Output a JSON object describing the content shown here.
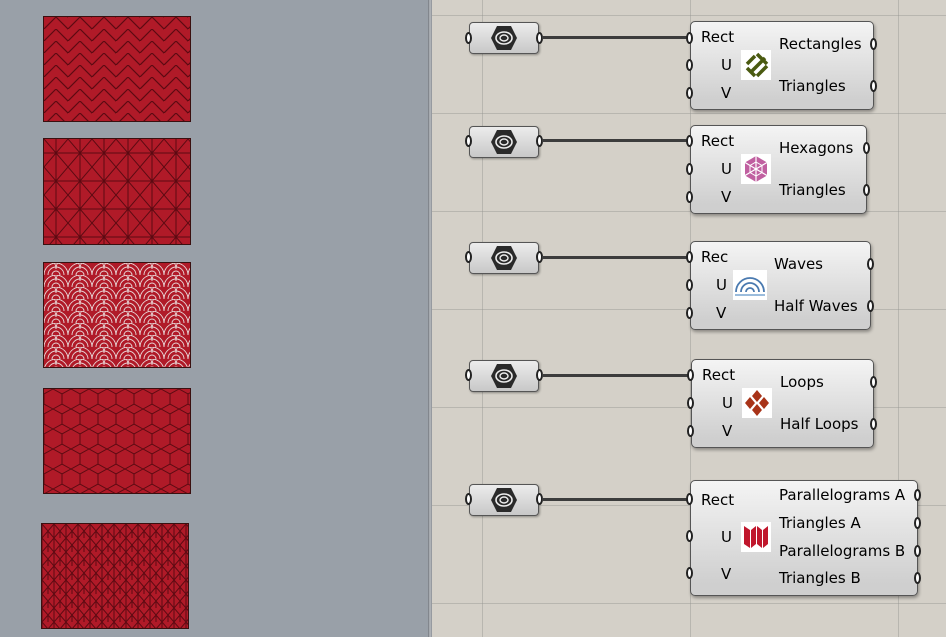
{
  "viewport": {
    "tiles": [
      {
        "pattern": "herringbone-icon"
      },
      {
        "pattern": "asanoha-star-icon"
      },
      {
        "pattern": "seigaiha-waves-icon"
      },
      {
        "pattern": "hexagon-grid-icon"
      },
      {
        "pattern": "knit-loops-icon"
      }
    ],
    "colors": {
      "tile_fill": "#b01a28",
      "tile_line": "#6a0a12",
      "background": "#99a0a8"
    }
  },
  "canvas": {
    "components": [
      {
        "inputs": [
          "Rect",
          "U",
          "V"
        ],
        "outputs": [
          "Rectangles",
          "Triangles"
        ],
        "icon": "rectangles-pattern-icon"
      },
      {
        "inputs": [
          "Rect",
          "U",
          "V"
        ],
        "outputs": [
          "Hexagons",
          "Triangles"
        ],
        "icon": "hexagons-pattern-icon"
      },
      {
        "inputs": [
          "Rec",
          "U",
          "V"
        ],
        "outputs": [
          "Waves",
          "Half Waves"
        ],
        "icon": "waves-pattern-icon"
      },
      {
        "inputs": [
          "Rect",
          "U",
          "V"
        ],
        "outputs": [
          "Loops",
          "Half Loops"
        ],
        "icon": "loops-pattern-icon"
      },
      {
        "inputs": [
          "Rect",
          "U",
          "V"
        ],
        "outputs": [
          "Parallelograms A",
          "Triangles A",
          "Parallelograms B",
          "Triangles B"
        ],
        "icon": "parallelograms-pattern-icon"
      }
    ],
    "colors": {
      "background": "#d4d0c8",
      "wire": "#3c3c3c"
    }
  }
}
